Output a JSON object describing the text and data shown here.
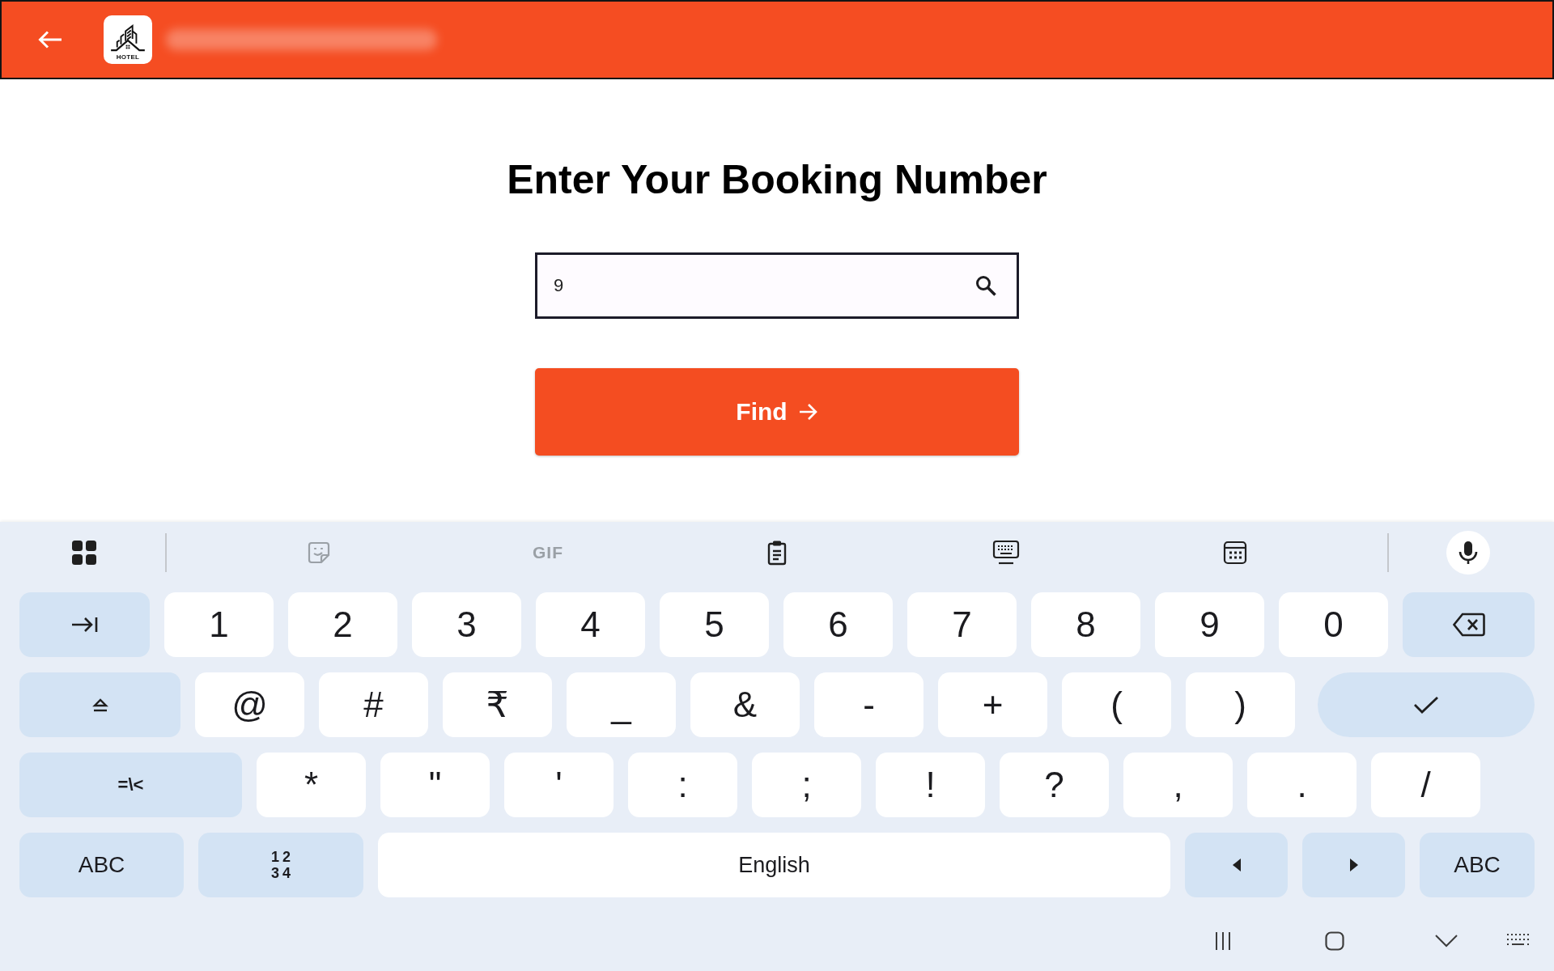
{
  "header": {
    "logo_text": "HOTEL"
  },
  "form": {
    "title": "Enter Your Booking Number",
    "booking_number": {
      "value": "9"
    },
    "find_button": {
      "label": "Find"
    }
  },
  "keyboard": {
    "toolbar": {
      "tools": [
        {
          "kind": "sticker",
          "disabled": true
        },
        {
          "kind": "gif",
          "label": "GIF",
          "disabled": true
        },
        {
          "kind": "clipboard",
          "disabled": false
        },
        {
          "kind": "layout",
          "disabled": false
        },
        {
          "kind": "numpad",
          "disabled": false
        }
      ]
    },
    "key_rows": [
      {
        "keys": [
          {
            "kind": "tab"
          },
          {
            "kind": "char",
            "label": "1"
          },
          {
            "kind": "char",
            "label": "2"
          },
          {
            "kind": "char",
            "label": "3"
          },
          {
            "kind": "char",
            "label": "4"
          },
          {
            "kind": "char",
            "label": "5"
          },
          {
            "kind": "char",
            "label": "6"
          },
          {
            "kind": "char",
            "label": "7"
          },
          {
            "kind": "char",
            "label": "8"
          },
          {
            "kind": "char",
            "label": "9"
          },
          {
            "kind": "char",
            "label": "0"
          },
          {
            "kind": "backspace"
          }
        ]
      },
      {
        "keys": [
          {
            "kind": "shift"
          },
          {
            "kind": "char",
            "label": "@"
          },
          {
            "kind": "char",
            "label": "#"
          },
          {
            "kind": "char",
            "label": "₹"
          },
          {
            "kind": "char",
            "label": "_"
          },
          {
            "kind": "char",
            "label": "&"
          },
          {
            "kind": "char",
            "label": "-"
          },
          {
            "kind": "char",
            "label": "+"
          },
          {
            "kind": "char",
            "label": "("
          },
          {
            "kind": "char",
            "label": ")"
          },
          {
            "kind": "enter"
          }
        ]
      },
      {
        "keys": [
          {
            "kind": "fn",
            "label": "=\\<"
          },
          {
            "kind": "char",
            "label": "*"
          },
          {
            "kind": "char",
            "label": "\""
          },
          {
            "kind": "char",
            "label": "'"
          },
          {
            "kind": "char",
            "label": ":"
          },
          {
            "kind": "char",
            "label": ";"
          },
          {
            "kind": "char",
            "label": "!"
          },
          {
            "kind": "char",
            "label": "?"
          },
          {
            "kind": "char",
            "label": ","
          },
          {
            "kind": "char",
            "label": "."
          },
          {
            "kind": "char",
            "label": "/"
          }
        ]
      },
      {
        "keys": [
          {
            "kind": "fn",
            "label": "ABC"
          },
          {
            "kind": "numbers",
            "lines": [
              "12",
              "34"
            ]
          },
          {
            "kind": "space",
            "label": "English"
          },
          {
            "kind": "left"
          },
          {
            "kind": "right"
          },
          {
            "kind": "fn",
            "label": "ABC"
          }
        ]
      }
    ]
  }
}
